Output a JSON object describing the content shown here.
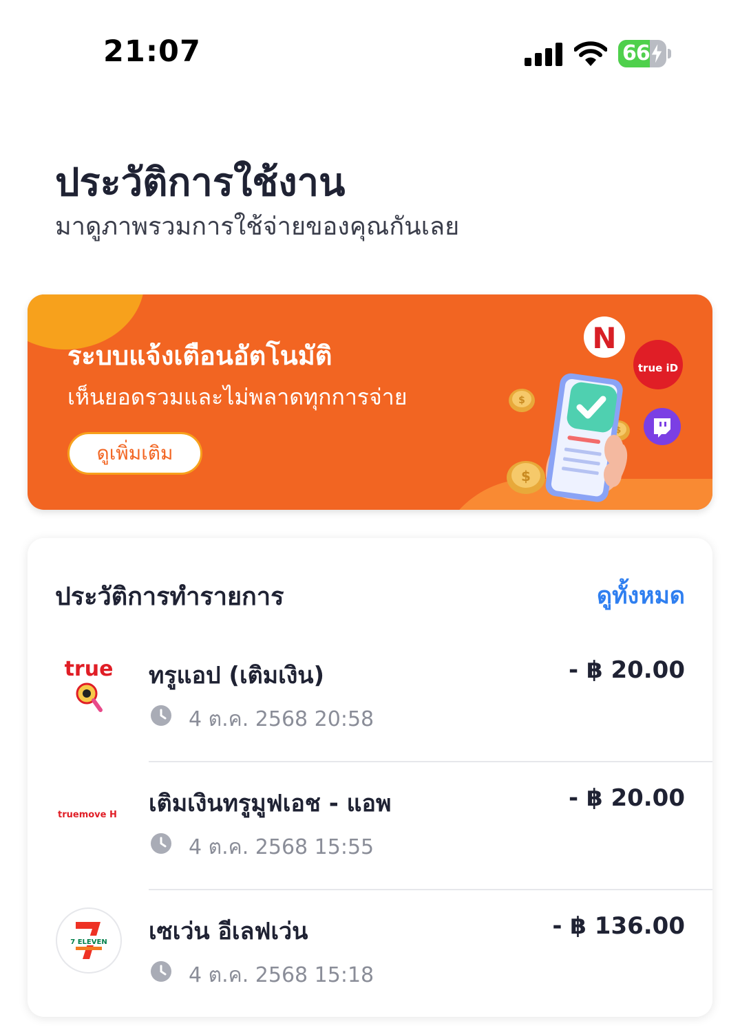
{
  "status_bar": {
    "time": "21:07",
    "battery": "66",
    "battery_level": 0.66
  },
  "header": {
    "title": "ประวัติการใช้งาน",
    "subtitle": "มาดูภาพรวมการใช้จ่ายของคุณกันเลย"
  },
  "banner": {
    "title": "ระบบแจ้งเตือนอัตโนมัติ",
    "text": "เห็นยอดรวมและไม่พลาดทุกการจ่าย",
    "button_label": "ดูเพิ่มเติม",
    "bg_color": "#f26522",
    "logos": [
      "N",
      "true iD"
    ]
  },
  "transactions": {
    "title": "ประวัติการทำรายการ",
    "view_all_label": "ดูทั้งหมด",
    "link_color": "#2f7ff0",
    "items": [
      {
        "name": "ทรูแอป (เติมเงิน)",
        "amount": "- ฿ 20.00",
        "date": "4 ต.ค. 2568 20:58",
        "logo": "true",
        "icon": "true-app-logo"
      },
      {
        "name": "เติมเงินทรูมูฟเอช - แอพ",
        "amount": "- ฿ 20.00",
        "date": "4 ต.ค. 2568 15:55",
        "logo": "truemove H",
        "icon": "truemove-h-logo"
      },
      {
        "name": "เซเว่น อีเลฟเว่น",
        "amount": "- ฿ 136.00",
        "date": "4 ต.ค. 2568 15:18",
        "logo": "7 ELEVEN",
        "icon": "seven-eleven-logo"
      }
    ]
  }
}
